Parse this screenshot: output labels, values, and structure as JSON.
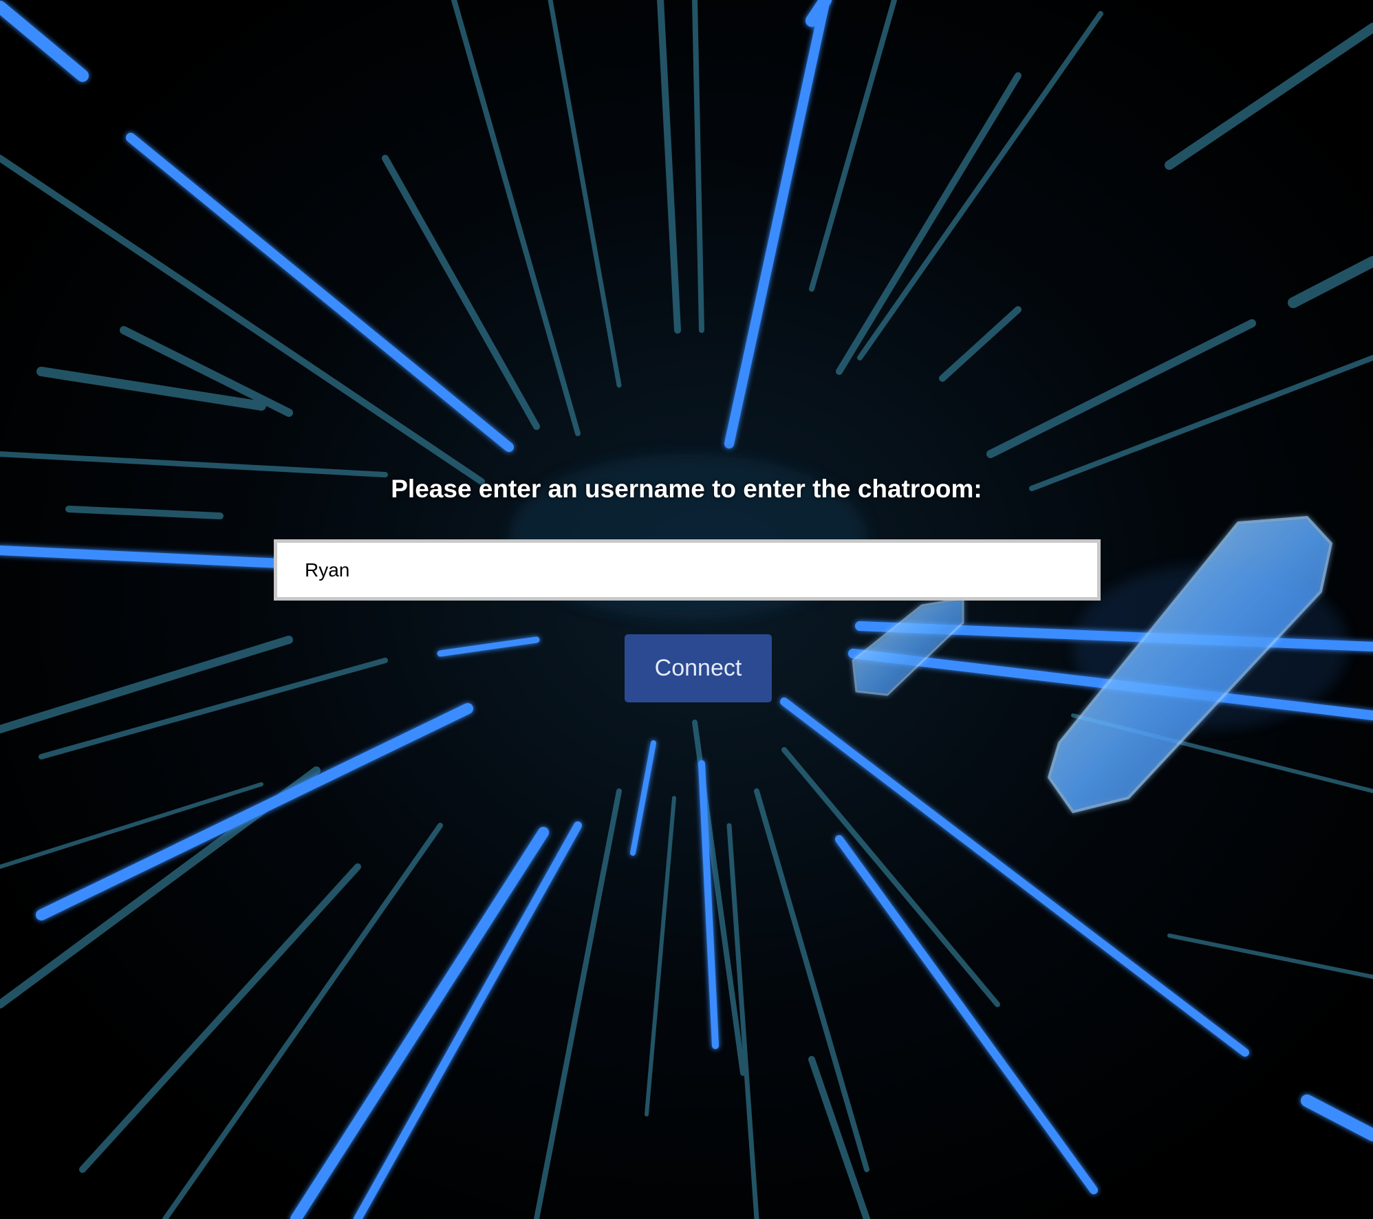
{
  "login": {
    "prompt": "Please enter an username to enter the chatroom:",
    "username_value": "Ryan",
    "connect_label": "Connect"
  },
  "theme": {
    "background": "#000000",
    "streak_blue": "#3a8dff",
    "streak_teal": "#2e6f86",
    "button_color": "#2b4a92",
    "text_color": "#ffffff"
  },
  "background": {
    "description_icon": "binary-data-tunnel-background"
  }
}
